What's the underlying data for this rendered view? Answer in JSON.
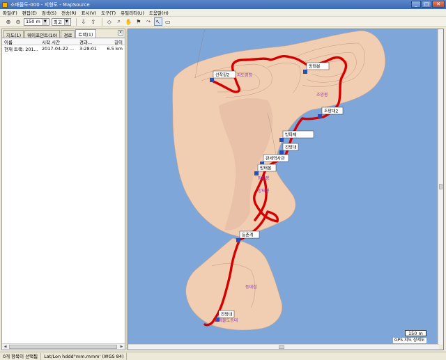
{
  "window": {
    "title": "소매물도-000 - 지형도 - MapSource"
  },
  "menu": [
    "파일(F)",
    "편집(E)",
    "검색(S)",
    "전송(R)",
    "표시(V)",
    "도구(T)",
    "유틸리티(U)",
    "도움말(H)"
  ],
  "toolbar": {
    "scale_value": "150 m",
    "detail_value": "최고"
  },
  "tabs": [
    "지도(1)",
    "웨이포인트(10)",
    "경로",
    "트랙(1)"
  ],
  "track_list": {
    "headers": [
      "이름",
      "시작 시간",
      "경과...",
      "길이"
    ],
    "rows": [
      {
        "name": "현재 트랙: 201...",
        "start": "2017-04-22 ...",
        "elapsed": "3:28:01",
        "length": "6.5 km"
      }
    ]
  },
  "waypoints": [
    "선착장2",
    "망태봉",
    "조망대2",
    "방파제",
    "전망대",
    "조망대1",
    "관세역사관",
    "망태봉",
    "등촌계",
    "전망대"
  ],
  "map_labels": [
    "지도명칭",
    "조망봉",
    "망태봉",
    "망태봉",
    "등대섬",
    "소매물도등대"
  ],
  "map": {
    "scale_label": "150 m",
    "gps_label": "GPS 지도 상세도",
    "sea_color": "#7ea6d9",
    "land_color": "#f1cdb2",
    "track_color": "#d40000"
  },
  "status": {
    "selection": "0개 항목이 선택됨",
    "coords": "Lat/Lon hddd°mm.mmm' (WGS 84)"
  }
}
